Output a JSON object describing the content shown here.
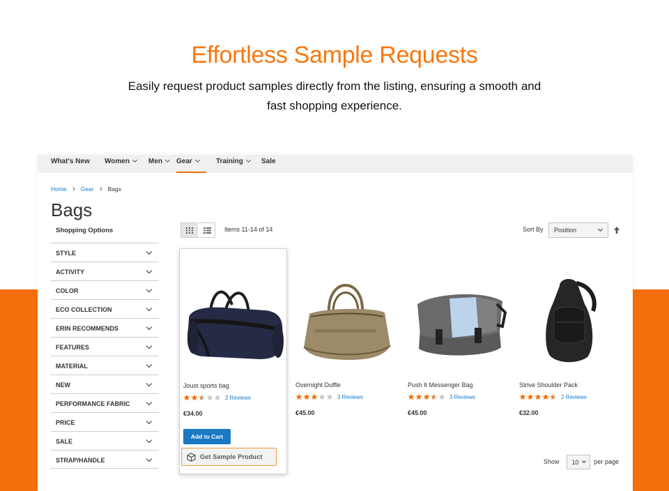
{
  "hero": {
    "title": "Effortless Sample Requests",
    "subtitle": "Easily request product samples directly from the listing, ensuring a smooth and fast shopping experience."
  },
  "colors": {
    "accent": "#f46f0b",
    "link": "#1979c3",
    "star": "#f46f0b"
  },
  "nav": {
    "items": [
      {
        "label": "What's New"
      },
      {
        "label": "Women",
        "icon": "chevron-down-icon"
      },
      {
        "label": "Men",
        "icon": "chevron-down-icon"
      },
      {
        "label": "Gear",
        "icon": "chevron-down-icon",
        "active": true
      },
      {
        "label": "Training",
        "icon": "chevron-down-icon"
      },
      {
        "label": "Sale"
      }
    ]
  },
  "breadcrumb": [
    "Home",
    "Gear",
    "Bags"
  ],
  "page": {
    "title": "Bags",
    "shopping_options": "Shopping Options"
  },
  "filters": [
    "STYLE",
    "ACTIVITY",
    "COLOR",
    "ECO COLLECTION",
    "ERIN RECOMMENDS",
    "FEATURES",
    "MATERIAL",
    "NEW",
    "PERFORMANCE FABRIC",
    "PRICE",
    "SALE",
    "STRAP/HANDLE"
  ],
  "toolbar": {
    "items_count": "Items 11-14 of 14",
    "sort_label": "Sort By",
    "sort_value": "Position",
    "show_label": "Show",
    "show_value": "10",
    "per_page": "per page"
  },
  "products": [
    {
      "name": "Joust sports bag",
      "rating": 2.5,
      "reviews": "2  Reviews",
      "price": "€34.00",
      "add_to_cart": "Add to Cart",
      "sample": "Get Sample Product"
    },
    {
      "name": "Overnight Duffle",
      "rating": 3,
      "reviews": "3  Reviews",
      "price": "€45.00"
    },
    {
      "name": "Push It Messenger Bag",
      "rating": 3.5,
      "reviews": "3  Reviews",
      "price": "€45.00"
    },
    {
      "name": "Strive Shoulder Pack",
      "rating": 4.5,
      "reviews": "2  Reviews",
      "price": "€32.00"
    }
  ]
}
